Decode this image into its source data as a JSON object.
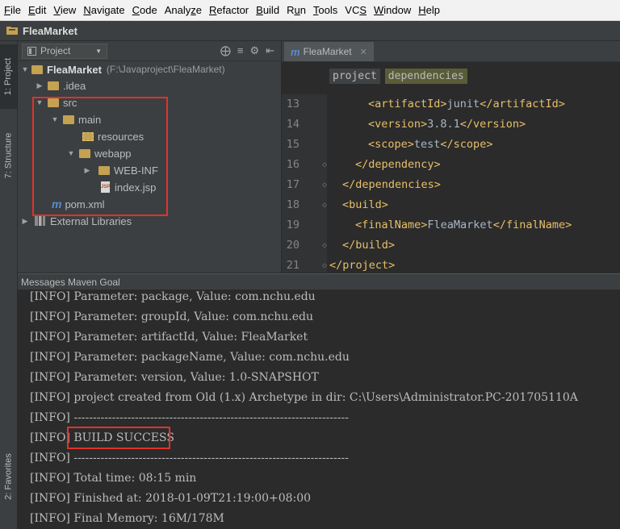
{
  "menu": [
    "File",
    "Edit",
    "View",
    "Navigate",
    "Code",
    "Analyze",
    "Refactor",
    "Build",
    "Run",
    "Tools",
    "VCS",
    "Window",
    "Help"
  ],
  "menu_mnemonic": [
    "F",
    "E",
    "V",
    "N",
    "C",
    "z",
    "R",
    "B",
    "u",
    "T",
    "S",
    "W",
    "H"
  ],
  "nav": {
    "project_name": "FleaMarket"
  },
  "side_tabs": {
    "project": "1: Project",
    "structure": "7: Structure",
    "favorites": "2: Favorites"
  },
  "project_panel": {
    "view_label": "Project",
    "tree": [
      {
        "label": "FleaMarket",
        "path": "(F:\\Javaproject\\FleaMarket)"
      },
      {
        "label": ".idea"
      },
      {
        "label": "src"
      },
      {
        "label": "main"
      },
      {
        "label": "resources"
      },
      {
        "label": "webapp"
      },
      {
        "label": "WEB-INF"
      },
      {
        "label": "index.jsp"
      },
      {
        "label": "pom.xml"
      },
      {
        "label": "External Libraries"
      }
    ]
  },
  "editor": {
    "tab_label": "FleaMarket",
    "breadcrumbs": [
      "project",
      "dependencies"
    ],
    "lines": [
      {
        "num": "13",
        "parts": [
          [
            "tag",
            "<artifactId>"
          ],
          [
            "txt",
            "junit"
          ],
          [
            "tag",
            "</artifactId>"
          ]
        ]
      },
      {
        "num": "14",
        "parts": [
          [
            "tag",
            "<version>"
          ],
          [
            "txt",
            "3.8.1"
          ],
          [
            "tag",
            "</version>"
          ]
        ]
      },
      {
        "num": "15",
        "parts": [
          [
            "tag",
            "<scope>"
          ],
          [
            "txt",
            "test"
          ],
          [
            "tag",
            "</scope>"
          ]
        ]
      },
      {
        "num": "16",
        "parts": [
          [
            "tag",
            "</dependency>"
          ]
        ]
      },
      {
        "num": "17",
        "parts": [
          [
            "tag",
            "</dependencies>"
          ]
        ]
      },
      {
        "num": "18",
        "parts": [
          [
            "tag",
            "<build>"
          ]
        ]
      },
      {
        "num": "19",
        "parts": [
          [
            "tag",
            "<finalName>"
          ],
          [
            "txt",
            "FleaMarket"
          ],
          [
            "tag",
            "</finalName>"
          ]
        ]
      },
      {
        "num": "20",
        "parts": [
          [
            "tag",
            "</build>"
          ]
        ]
      },
      {
        "num": "21",
        "parts": [
          [
            "tag",
            "</project>"
          ]
        ]
      }
    ]
  },
  "messages": {
    "title": "Messages Maven Goal",
    "lines": [
      "[INFO] Parameter: package, Value: com.nchu.edu",
      "[INFO] Parameter: groupId, Value: com.nchu.edu",
      "[INFO] Parameter: artifactId, Value: FleaMarket",
      "[INFO] Parameter: packageName, Value: com.nchu.edu",
      "[INFO] Parameter: version, Value: 1.0-SNAPSHOT",
      "[INFO] project created from Old (1.x) Archetype in dir: C:\\Users\\Administrator.PC-201705110A",
      "[INFO] ------------------------------------------------------------------------",
      "[INFO] BUILD SUCCESS",
      "[INFO] ------------------------------------------------------------------------",
      "[INFO] Total time: 08:15 min",
      "[INFO] Finished at: 2018-01-09T21:19:00+08:00",
      "[INFO] Final Memory: 16M/178M"
    ]
  },
  "colors": {
    "highlight_box": "#e0322a",
    "xml_tag": "#e8bf6a",
    "xml_text": "#a9b7c6"
  }
}
